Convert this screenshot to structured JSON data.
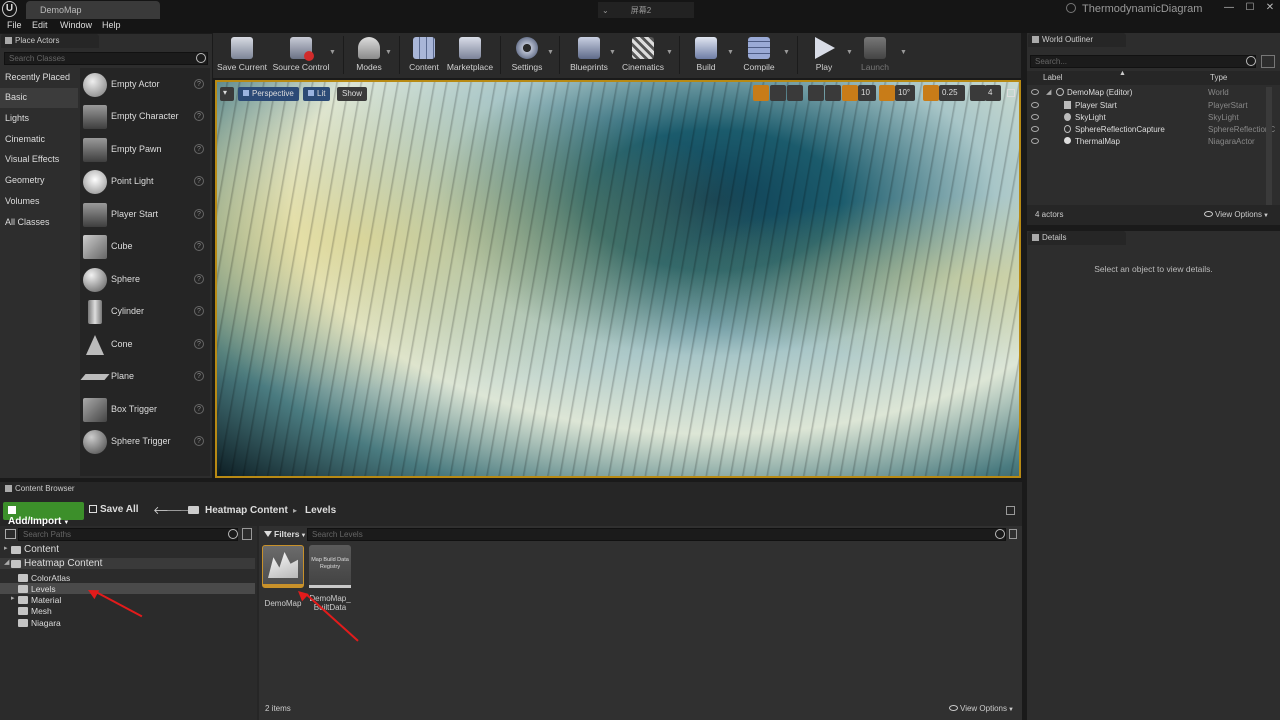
{
  "window": {
    "doc_tab": "DemoMap",
    "title_chevron": "⌄",
    "title": "屏幕2",
    "project_name": "ThermodynamicDiagram",
    "min_glyph": "—",
    "max_glyph": "☐",
    "close_glyph": "✕"
  },
  "menu": [
    "File",
    "Edit",
    "Window",
    "Help"
  ],
  "place_actors": {
    "tab_label": "Place Actors",
    "search_placeholder": "Search Classes",
    "categories": [
      "Recently Placed",
      "Basic",
      "Lights",
      "Cinematic",
      "Visual Effects",
      "Geometry",
      "Volumes",
      "All Classes"
    ],
    "active_category": "Basic",
    "items": [
      "Empty Actor",
      "Empty Character",
      "Empty Pawn",
      "Point Light",
      "Player Start",
      "Cube",
      "Sphere",
      "Cylinder",
      "Cone",
      "Plane",
      "Box Trigger",
      "Sphere Trigger"
    ],
    "help_glyph": "?"
  },
  "toolbar": {
    "items": [
      "Save Current",
      "Source Control",
      "Modes",
      "Content",
      "Marketplace",
      "Settings",
      "Blueprints",
      "Cinematics",
      "Build",
      "Compile",
      "Play",
      "Launch"
    ],
    "drop_glyph": "▼"
  },
  "viewport": {
    "menu_glyph": "▾",
    "perspective": "Perspective",
    "lit": "Lit",
    "show": "Show",
    "grid_snap": "10",
    "rot_snap": "10°",
    "scale_snap": "0.25",
    "cam_speed": "4"
  },
  "outliner": {
    "tab_label": "World Outliner",
    "search_placeholder": "Search...",
    "col_label": "Label",
    "col_type": "Type",
    "sort_glyph": "▲",
    "rows": [
      {
        "label": "DemoMap (Editor)",
        "type": "World"
      },
      {
        "label": "Player Start",
        "type": "PlayerStart"
      },
      {
        "label": "SkyLight",
        "type": "SkyLight"
      },
      {
        "label": "SphereReflectionCapture",
        "type": "SphereReflectionC"
      },
      {
        "label": "ThermalMap",
        "type": "NiagaraActor"
      }
    ],
    "count": "4 actors",
    "view_options": "View Options"
  },
  "details": {
    "tab_label": "Details",
    "empty_msg": "Select an object to view details."
  },
  "content_browser": {
    "tab_label": "Content Browser",
    "add_import": "Add/Import",
    "save_all": "Save All",
    "back_glyph": "🡐",
    "forward_glyph": "🡒",
    "path": [
      "Heatmap Content",
      "Levels"
    ],
    "path_sep": "▸",
    "search_paths_placeholder": "Search Paths",
    "filters": "Filters",
    "search_levels_placeholder": "Search Levels",
    "tree": [
      {
        "label": "Content"
      },
      {
        "label": "Heatmap Content"
      },
      {
        "label": "ColorAtlas"
      },
      {
        "label": "Levels"
      },
      {
        "label": "Material"
      },
      {
        "label": "Mesh"
      },
      {
        "label": "Niagara"
      }
    ],
    "assets": [
      {
        "label": "DemoMap",
        "thumb_text": ""
      },
      {
        "label": "DemoMap_BuiltData",
        "label_lines": [
          "DemoMap_",
          "BuiltData"
        ],
        "thumb_text": "Map Build Data Registry"
      }
    ],
    "items_count": "2 items",
    "view_options": "View Options"
  },
  "colors": {
    "accent_orange": "#b88a14",
    "add_import_green": "#3c8f2a",
    "annotation_red": "#e31b1b"
  }
}
